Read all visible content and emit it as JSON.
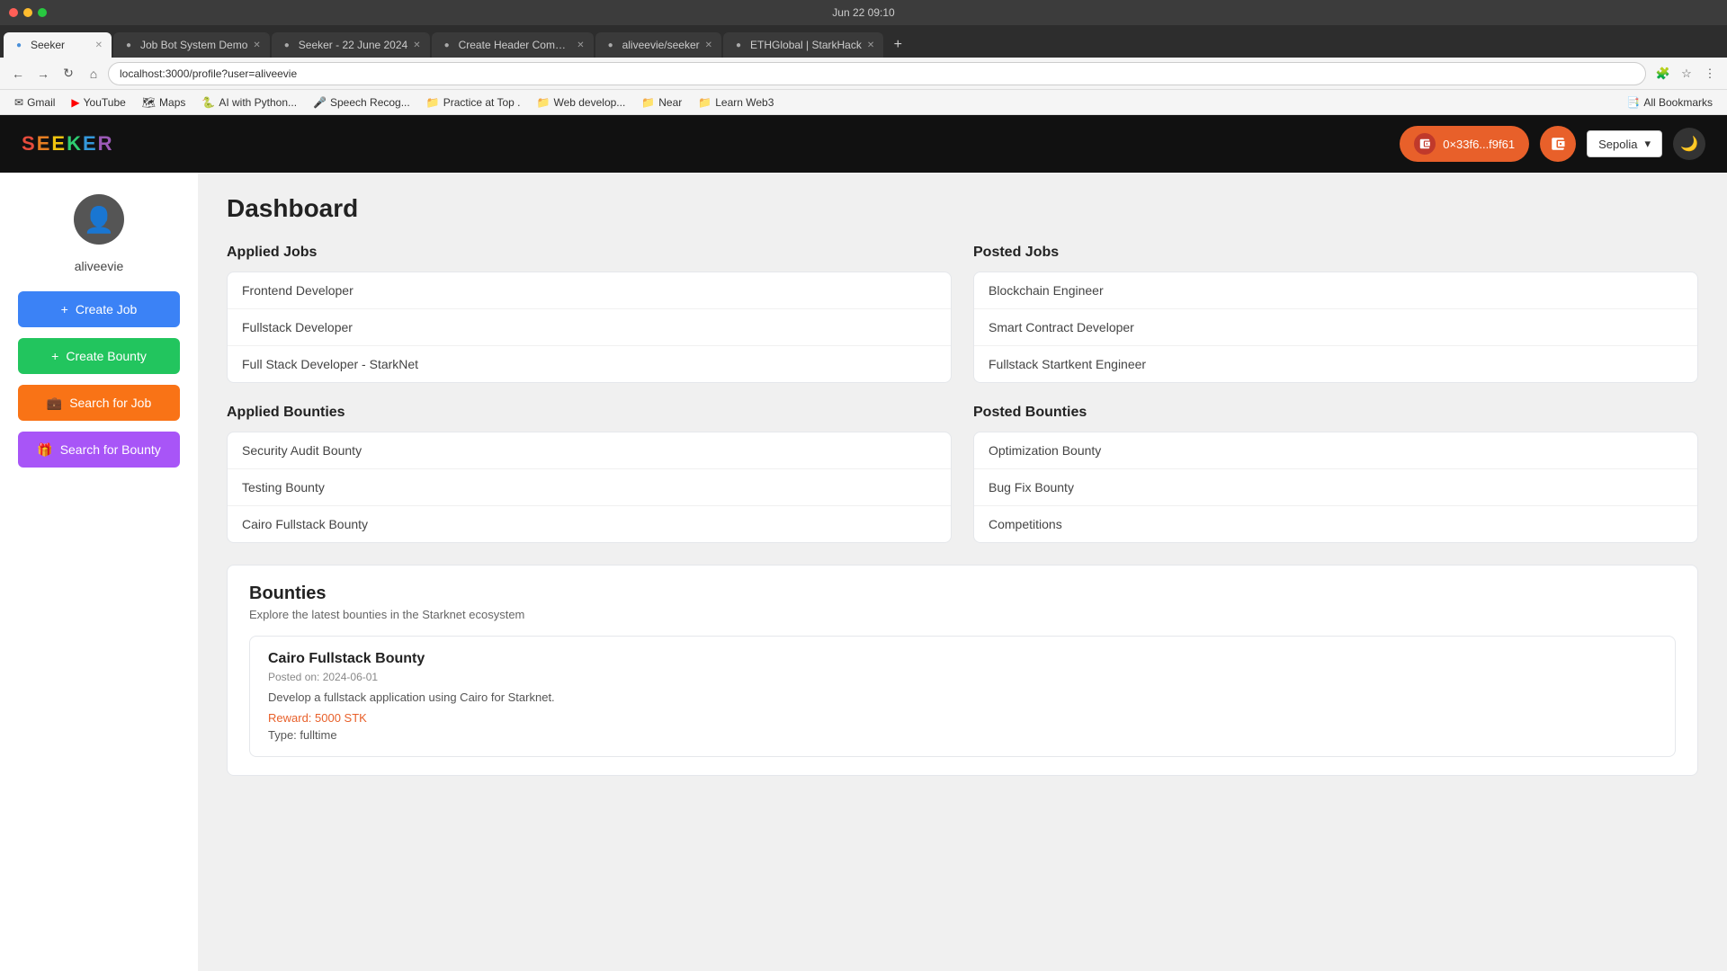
{
  "browser": {
    "titlebar": {
      "title": "Jun 22  09:10",
      "dots": [
        "red",
        "yellow",
        "green"
      ]
    },
    "tabs": [
      {
        "id": "tab-seeker",
        "favicon": "S",
        "label": "Seeker",
        "active": true
      },
      {
        "id": "tab-jobbot",
        "favicon": "J",
        "label": "Job Bot System Demo",
        "active": false
      },
      {
        "id": "tab-seeker22",
        "favicon": "S",
        "label": "Seeker - 22 June 2024",
        "active": false
      },
      {
        "id": "tab-createheader",
        "favicon": "C",
        "label": "Create Header Compon...",
        "active": false
      },
      {
        "id": "tab-aliveevie",
        "favicon": "A",
        "label": "aliveevie/seeker",
        "active": false
      },
      {
        "id": "tab-ethglobal",
        "favicon": "E",
        "label": "ETHGlobal | StarkHack",
        "active": false
      }
    ],
    "address": "localhost:3000/profile?user=aliveevie",
    "bookmarks": [
      {
        "label": "Gmail",
        "icon": "✉"
      },
      {
        "label": "YouTube",
        "icon": "▶"
      },
      {
        "label": "Maps",
        "icon": "🗺"
      },
      {
        "label": "AI with Python...",
        "icon": "🐍"
      },
      {
        "label": "Speech Recog...",
        "icon": "🎤"
      },
      {
        "label": "Practice at Top .",
        "icon": "📁",
        "folder": true
      },
      {
        "label": "Web develop...",
        "icon": "📁",
        "folder": true
      },
      {
        "label": "Near",
        "icon": "📁",
        "folder": true
      },
      {
        "label": "Learn Web3",
        "icon": "📁",
        "folder": true
      },
      {
        "label": "All Bookmarks",
        "icon": "📁",
        "folder": true
      }
    ]
  },
  "header": {
    "logo": "SEEKER",
    "logo_letters": [
      "S",
      "E",
      "E",
      "K",
      "E",
      "R"
    ],
    "wallet_address": "0×33f6...f9f61",
    "network": "Sepolia",
    "dark_mode_icon": "🌙"
  },
  "sidebar": {
    "username": "aliveevie",
    "buttons": [
      {
        "id": "create-job",
        "label": "Create Job",
        "icon": "+"
      },
      {
        "id": "create-bounty",
        "label": "Create Bounty",
        "icon": "+"
      },
      {
        "id": "search-job",
        "label": "Search for Job",
        "icon": "💼"
      },
      {
        "id": "search-bounty",
        "label": "Search for Bounty",
        "icon": "🎁"
      }
    ]
  },
  "dashboard": {
    "title": "Dashboard",
    "applied_jobs": {
      "heading": "Applied Jobs",
      "items": [
        {
          "label": "Frontend Developer"
        },
        {
          "label": "Fullstack Developer"
        },
        {
          "label": "Full Stack Developer - StarkNet"
        }
      ]
    },
    "posted_jobs": {
      "heading": "Posted Jobs",
      "items": [
        {
          "label": "Blockchain Engineer"
        },
        {
          "label": "Smart Contract Developer"
        },
        {
          "label": "Fullstack Startkent Engineer"
        }
      ]
    },
    "applied_bounties": {
      "heading": "Applied Bounties",
      "items": [
        {
          "label": "Security Audit Bounty"
        },
        {
          "label": "Testing Bounty"
        },
        {
          "label": "Cairo Fullstack Bounty"
        }
      ]
    },
    "posted_bounties": {
      "heading": "Posted Bounties",
      "items": [
        {
          "label": "Optimization Bounty"
        },
        {
          "label": "Bug Fix Bounty"
        },
        {
          "label": "Competitions"
        }
      ]
    },
    "bounties_section": {
      "title": "Bounties",
      "subtitle": "Explore the latest bounties in the Starknet ecosystem",
      "featured": {
        "name": "Cairo Fullstack Bounty",
        "posted": "Posted on: 2024-06-01",
        "description": "Develop a fullstack application using Cairo for Starknet.",
        "reward": "Reward: 5000 STK",
        "type": "Type: fulltime"
      }
    }
  }
}
